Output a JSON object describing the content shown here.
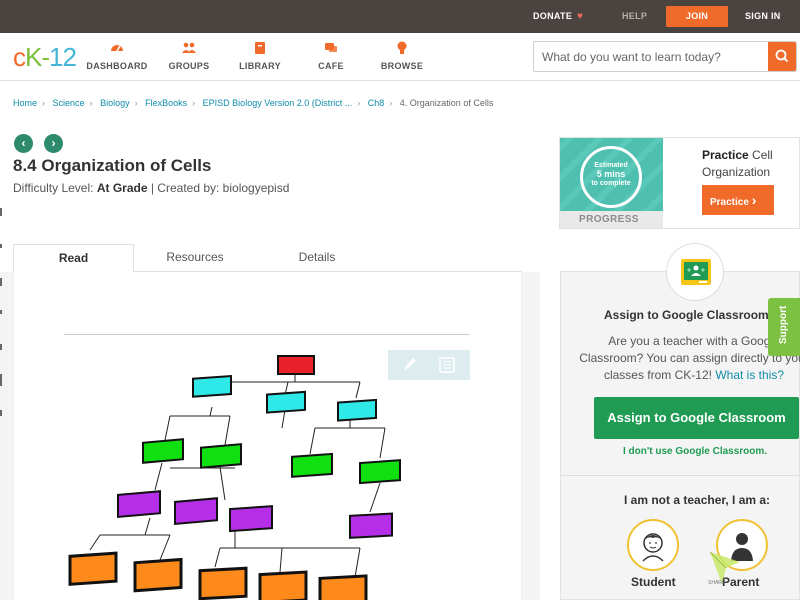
{
  "topbar": {
    "donate": "DONATE",
    "help": "HELP",
    "join": "JOIN",
    "signin": "SIGN IN"
  },
  "logo": {
    "c": "c",
    "k": "K",
    "dash": "-",
    "num": "12"
  },
  "nav": [
    {
      "label": "DASHBOARD",
      "icon": "dashboard-icon"
    },
    {
      "label": "GROUPS",
      "icon": "groups-icon"
    },
    {
      "label": "LIBRARY",
      "icon": "library-icon"
    },
    {
      "label": "CAFE",
      "icon": "cafe-icon"
    },
    {
      "label": "BROWSE",
      "icon": "browse-icon"
    }
  ],
  "search": {
    "placeholder": "What do you want to learn today?"
  },
  "breadcrumb": {
    "items": [
      "Home",
      "Science",
      "Biology",
      "FlexBooks",
      "EPISD Biology Version 2.0 (District ...",
      "Ch8"
    ],
    "current": "4. Organization of Cells"
  },
  "page": {
    "title": "8.4 Organization of Cells",
    "difficulty_label": "Difficulty Level:",
    "difficulty_value": "At Grade",
    "created_by": "| Created by: biologyepisd"
  },
  "tabs": {
    "read": "Read",
    "resources": "Resources",
    "details": "Details"
  },
  "practice": {
    "circle_line1": "Estimated",
    "circle_line2": "5 mins",
    "circle_line3": "to complete",
    "progress_label": "PROGRESS",
    "title_bold": "Practice",
    "title_rest": " Cell Organization",
    "button": "Practice"
  },
  "google": {
    "title": "Assign to Google Classroom",
    "text": "Are you a teacher with a Google Classroom? You can assign directly to your classes from CK-12!",
    "link": "What is this?",
    "button": "Assign to Google Classroom",
    "no_link": "I don't use Google Classroom.",
    "role_prompt": "I am not a teacher, I am a:",
    "student": "Student",
    "parent": "Parent"
  },
  "support": "Support",
  "share": "SHARE",
  "colors": {
    "accent": "#f06b2a",
    "green": "#1f9b53",
    "teal": "#2e8a6d",
    "topbar": "#4a4340",
    "link": "#0f8ca8"
  }
}
